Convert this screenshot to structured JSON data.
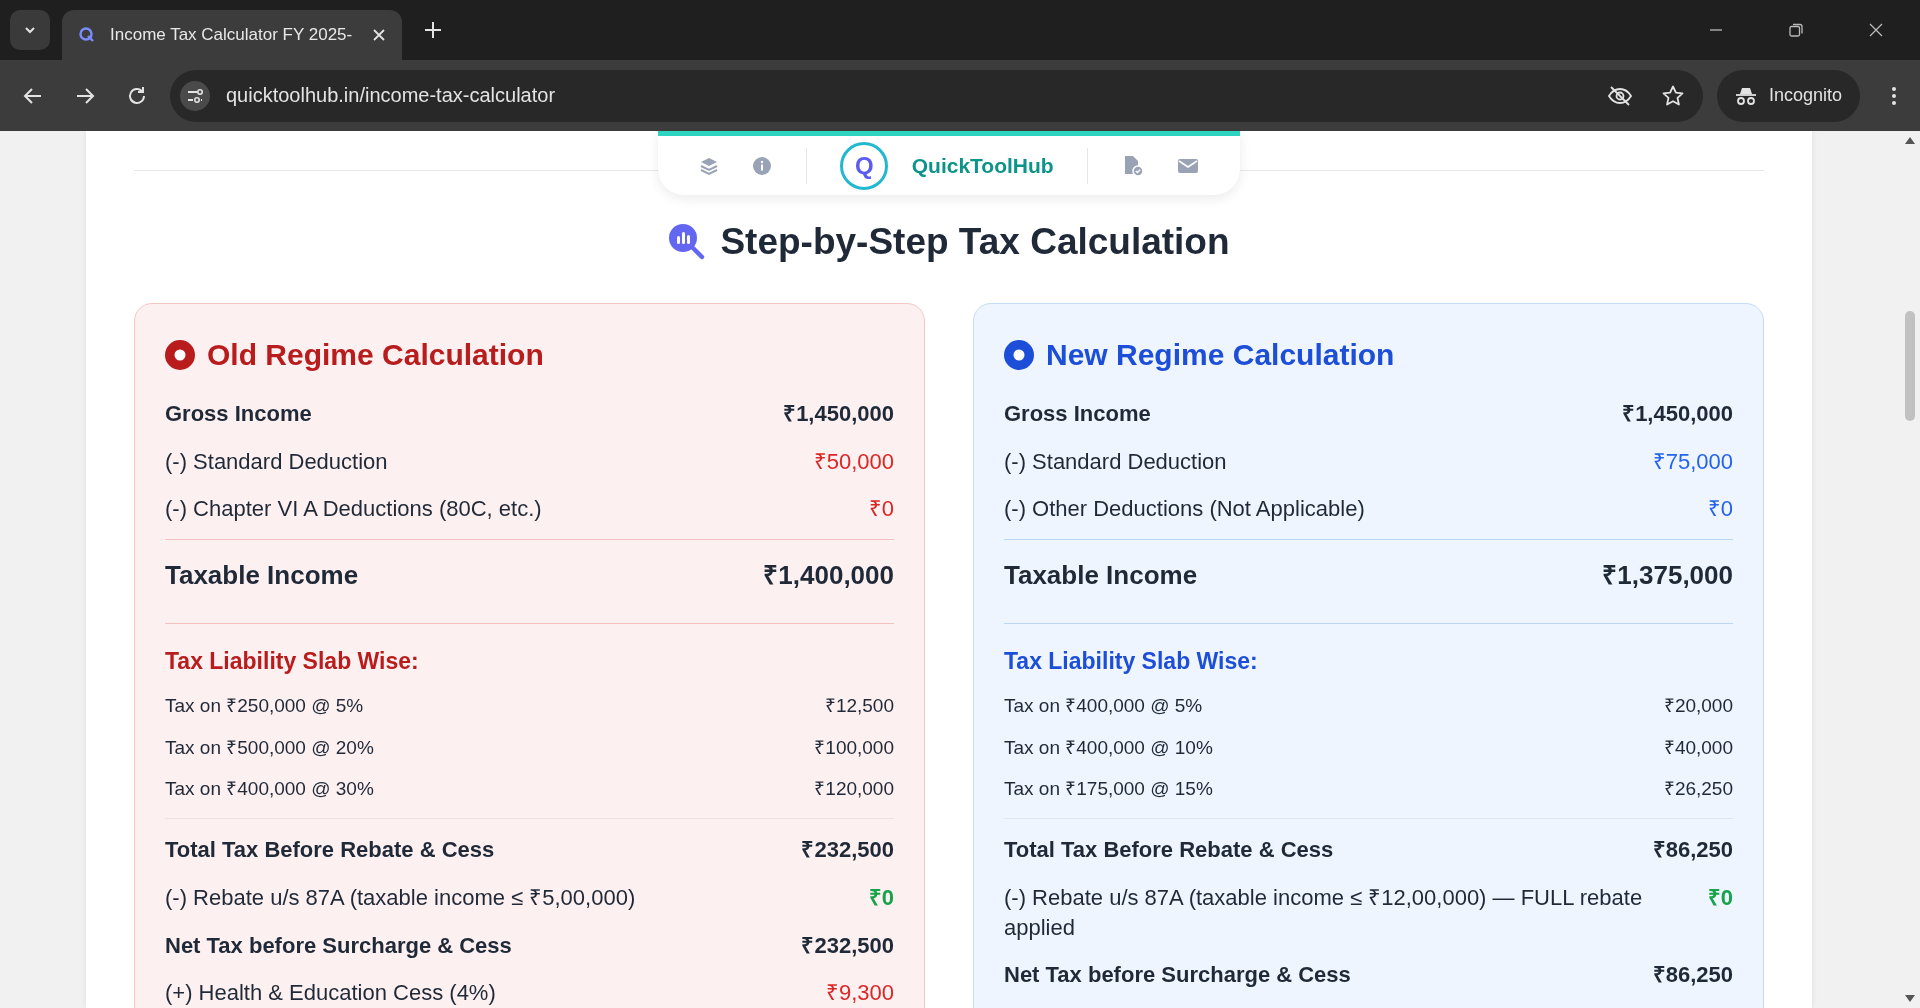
{
  "browser": {
    "tab_title": "Income Tax Calculator FY 2025-",
    "url": "quicktoolhub.in/income-tax-calculator",
    "profile": "Incognito"
  },
  "nav": {
    "brand": "QuickToolHub",
    "logo_letter": "Q"
  },
  "heading": "Step-by-Step Tax Calculation",
  "regimes": [
    {
      "kind": "old",
      "title": "Old Regime Calculation",
      "rows": [
        {
          "kind": "strong",
          "label": "Gross Income",
          "value": "₹1,450,000",
          "color": "#1f2937"
        },
        {
          "kind": "plain",
          "label": "(-) Standard Deduction",
          "value": "₹50,000",
          "color": "#dc2626"
        },
        {
          "kind": "plain",
          "label": "(-) Chapter VI A Deductions (80C, etc.)",
          "value": "₹0",
          "color": "#dc2626"
        },
        {
          "kind": "taxable",
          "label": "Taxable Income",
          "value": "₹1,400,000",
          "color": "#1f2937"
        },
        {
          "kind": "section",
          "label": "Tax Liability Slab Wise:"
        },
        {
          "kind": "slab",
          "label": "Tax on ₹250,000 @ 5%",
          "value": "₹12,500",
          "color": "#1f2937"
        },
        {
          "kind": "slab",
          "label": "Tax on ₹500,000 @ 20%",
          "value": "₹100,000",
          "color": "#1f2937"
        },
        {
          "kind": "slab",
          "label": "Tax on ₹400,000 @ 30%",
          "value": "₹120,000",
          "color": "#1f2937"
        },
        {
          "kind": "sum",
          "label": "Total Tax Before Rebate & Cess",
          "value": "₹232,500",
          "color": "#1f2937"
        },
        {
          "kind": "plain",
          "label": "(-) Rebate u/s 87A (taxable income ≤ ₹5,00,000)",
          "value": "₹0",
          "color": "#16a34a",
          "value_bold": true
        },
        {
          "kind": "strong",
          "label": "Net Tax before Surcharge & Cess",
          "value": "₹232,500",
          "color": "#1f2937"
        },
        {
          "kind": "plain",
          "label": "(+) Health & Education Cess (4%)",
          "value": "₹9,300",
          "color": "#dc2626"
        }
      ]
    },
    {
      "kind": "new",
      "title": "New Regime Calculation",
      "rows": [
        {
          "kind": "strong",
          "label": "Gross Income",
          "value": "₹1,450,000",
          "color": "#1f2937"
        },
        {
          "kind": "plain",
          "label": "(-) Standard Deduction",
          "value": "₹75,000",
          "color": "#2563eb"
        },
        {
          "kind": "plain",
          "label": "(-) Other Deductions (Not Applicable)",
          "value": "₹0",
          "color": "#2563eb"
        },
        {
          "kind": "taxable",
          "label": "Taxable Income",
          "value": "₹1,375,000",
          "color": "#1f2937"
        },
        {
          "kind": "section",
          "label": "Tax Liability Slab Wise:"
        },
        {
          "kind": "slab",
          "label": "Tax on ₹400,000 @ 5%",
          "value": "₹20,000",
          "color": "#1f2937"
        },
        {
          "kind": "slab",
          "label": "Tax on ₹400,000 @ 10%",
          "value": "₹40,000",
          "color": "#1f2937"
        },
        {
          "kind": "slab",
          "label": "Tax on ₹175,000 @ 15%",
          "value": "₹26,250",
          "color": "#1f2937"
        },
        {
          "kind": "sum",
          "label": "Total Tax Before Rebate & Cess",
          "value": "₹86,250",
          "color": "#1f2937"
        },
        {
          "kind": "plain",
          "label": "(-) Rebate u/s 87A (taxable income ≤ ₹12,00,000) — FULL rebate applied",
          "value": "₹0",
          "color": "#16a34a",
          "value_bold": true
        },
        {
          "kind": "strong",
          "label": "Net Tax before Surcharge & Cess",
          "value": "₹86,250",
          "color": "#1f2937"
        }
      ]
    }
  ]
}
